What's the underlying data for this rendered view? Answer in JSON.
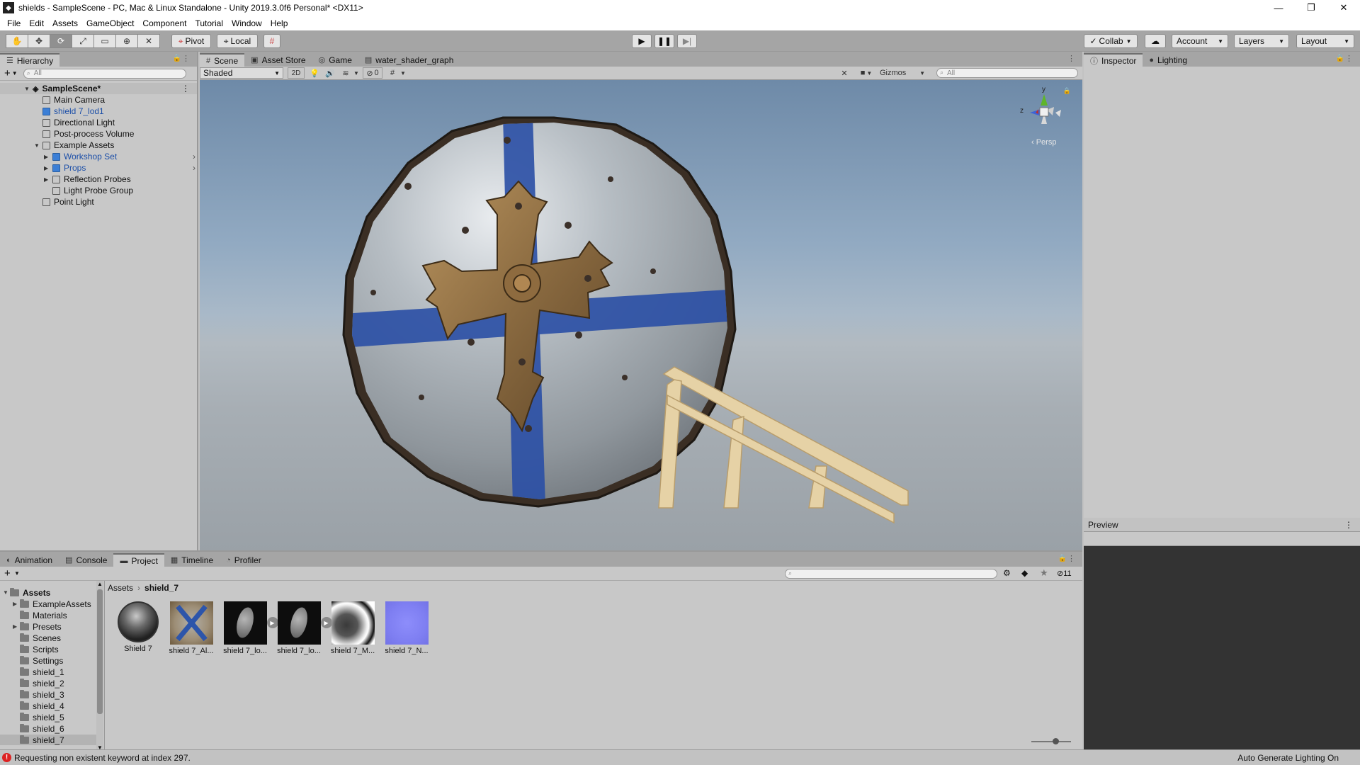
{
  "window": {
    "title": "shields - SampleScene - PC, Mac & Linux Standalone - Unity 2019.3.0f6 Personal* <DX11>",
    "controls": [
      "—",
      "❐",
      "✕"
    ]
  },
  "menu": [
    "File",
    "Edit",
    "Assets",
    "GameObject",
    "Component",
    "Tutorial",
    "Window",
    "Help"
  ],
  "toolbar": {
    "pivot": "Pivot",
    "local": "Local",
    "collab": "Collab",
    "account": "Account",
    "layers": "Layers",
    "layout": "Layout"
  },
  "hierarchy": {
    "tab": "Hierarchy",
    "search_placeholder": "All",
    "scene": "SampleScene*",
    "items": [
      {
        "label": "Main Camera"
      },
      {
        "label": "shield 7_lod1"
      },
      {
        "label": "Directional Light"
      },
      {
        "label": "Post-process Volume"
      },
      {
        "label": "Example Assets"
      },
      {
        "label": "Workshop Set"
      },
      {
        "label": "Props"
      },
      {
        "label": "Reflection Probes"
      },
      {
        "label": "Light Probe Group"
      },
      {
        "label": "Point Light"
      }
    ]
  },
  "scene_tabs": [
    "Scene",
    "Asset Store",
    "Game",
    "water_shader_graph"
  ],
  "scene_bar": {
    "shading": "Shaded",
    "mode_2d": "2D",
    "hidden_count": "0",
    "gizmos": "Gizmos",
    "search_placeholder": "All"
  },
  "gizmo": {
    "y": "y",
    "z": "z",
    "persp": "‹ Persp"
  },
  "inspector_tabs": [
    "Inspector",
    "Lighting"
  ],
  "preview": {
    "title": "Preview"
  },
  "bottom_tabs": [
    "Animation",
    "Console",
    "Project",
    "Timeline",
    "Profiler"
  ],
  "project": {
    "hidden_count": "11",
    "tree": [
      "Assets",
      "ExampleAssets",
      "Materials",
      "Presets",
      "Scenes",
      "Scripts",
      "Settings",
      "shield_1",
      "shield_2",
      "shield_3",
      "shield_4",
      "shield_5",
      "shield_6",
      "shield_7"
    ],
    "breadcrumb": [
      "Assets",
      "shield_7"
    ],
    "assets": [
      {
        "label": "Shield 7"
      },
      {
        "label": "shield 7_Al..."
      },
      {
        "label": "shield 7_lo..."
      },
      {
        "label": "shield 7_lo..."
      },
      {
        "label": "shield 7_M..."
      },
      {
        "label": "shield 7_N..."
      }
    ]
  },
  "status": {
    "error": "Requesting non existent keyword at index 297.",
    "right": "Auto Generate Lighting On"
  }
}
